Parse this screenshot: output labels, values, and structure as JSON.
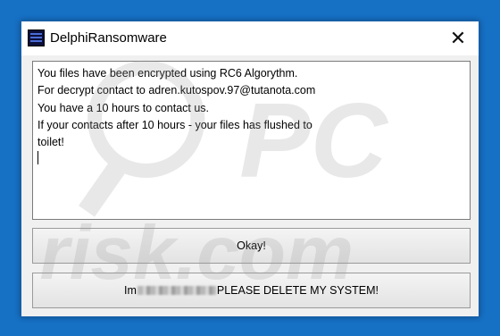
{
  "window": {
    "title": "DelphiRansomware",
    "close_glyph": "✕"
  },
  "message": {
    "text": "You files have been encrypted using RC6 Algorythm.\nFor decrypt contact to adren.kutospov.97@tutanota.com\nYou have a 10 hours to contact us.\nIf your contacts after 10 hours - your files has flushed to\ntoilet!\n"
  },
  "buttons": {
    "okay_label": "Okay!",
    "delete_prefix": "Im",
    "delete_suffix": "PLEASE DELETE MY SYSTEM!"
  },
  "watermark": {
    "text": "PC risk.com"
  },
  "colors": {
    "desktop": "#1670c4",
    "window_bg": "#f0f0f0",
    "watermark": "#c8c8c8"
  },
  "icons": {
    "app": "delphi-app-icon",
    "close": "close-icon"
  }
}
